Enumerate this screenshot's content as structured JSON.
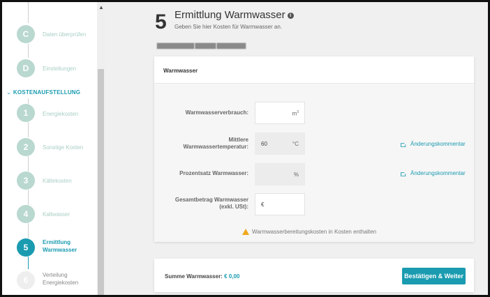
{
  "sidebar": {
    "items_top": [
      {
        "badge": "C",
        "label": "Daten überprüfen"
      },
      {
        "badge": "D",
        "label": "Einstellungen"
      }
    ],
    "section_label": "KOSTENAUFSTELLUNG",
    "items": [
      {
        "badge": "1",
        "label": "Energiekosten"
      },
      {
        "badge": "2",
        "label": "Sonstige Kosten"
      },
      {
        "badge": "3",
        "label": "Kältekosten"
      },
      {
        "badge": "4",
        "label": "Kaltwasser"
      },
      {
        "badge": "5",
        "label_line1": "Ermittlung",
        "label_line2": "Warmwasser",
        "state": "active"
      },
      {
        "badge": "6",
        "label_line1": "Verteilung",
        "label_line2": "Energiekosten",
        "state": "upcoming"
      }
    ]
  },
  "page": {
    "step_number": "5",
    "title": "Ermittlung Warmwasser",
    "subtitle": "Geben Sie hier Kosten für Warmwasser an.",
    "redacted_line": "▇▇▇▇▇▇▇▇▇ ▇▇▇▇▇ ▇▇▇▇▇▇▇"
  },
  "form_card": {
    "title": "Warmwasser",
    "fields": [
      {
        "label": "Warmwasserverbrauch:",
        "value": "",
        "unit_base": "m",
        "unit_sup": "3"
      },
      {
        "label_line1": "Mittlere",
        "label_line2": "Warmwassertemperatur:",
        "value": "60",
        "unit": "°C",
        "disabled": true,
        "comment": "Änderungskommentar"
      },
      {
        "label": "Prozentsatz Warmwasser:",
        "value": "",
        "unit": "%",
        "disabled": true,
        "comment": "Änderungskommentar"
      },
      {
        "label_line1": "Gesamtbetrag Warmwasser",
        "label_line2": "(exkl. USt):",
        "value": "€",
        "unit": ""
      }
    ],
    "warning": "Warmwasserbereitungskosten in Kosten enthalten"
  },
  "summary": {
    "label": "Summe Warmwasser:",
    "value": "€ 0,00",
    "button_label": "Bestätigen & Weiter"
  },
  "colors": {
    "accent": "#1a9bb0",
    "step_done": "#b9d8cf",
    "warning": "#f0a81e"
  }
}
